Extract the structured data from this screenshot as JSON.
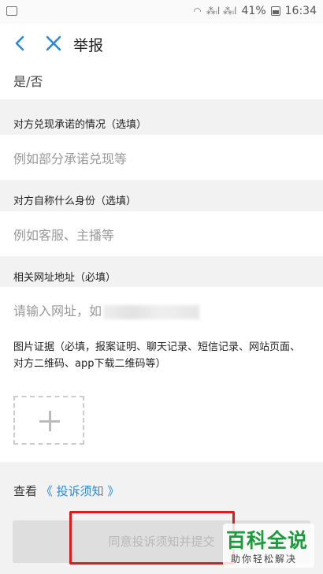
{
  "status_bar": {
    "signal_text": "⁂ᵢl ⁂ᵢl",
    "battery": "41%",
    "time": "16:34"
  },
  "nav": {
    "title": "举报"
  },
  "rows": {
    "yes_no_value": "是/否",
    "promise_label": "对方兑现承诺的情况（选填）",
    "promise_placeholder": "例如部分承诺兑现等",
    "identity_label": "对方自称什么身份（选填）",
    "identity_placeholder": "例如客服、主播等",
    "url_label": "相关网址地址（必填）",
    "url_placeholder": "请输入网址，如",
    "evidence_label_line1": "图片证据（必填，报案证明、聊天记录、短信记录、网站页面、",
    "evidence_label_line2": "对方二维码、app下载二维码等）"
  },
  "notice": {
    "prefix": "查看",
    "link": "《 投诉须知 》"
  },
  "submit_label": "同意投诉须知并提交",
  "watermark": {
    "main": "百科全说",
    "sub": "助你轻松解决"
  },
  "colors": {
    "accent": "#2a8ad6",
    "highlight": "#e0191a",
    "watermark_green": "#1c9b3d"
  }
}
